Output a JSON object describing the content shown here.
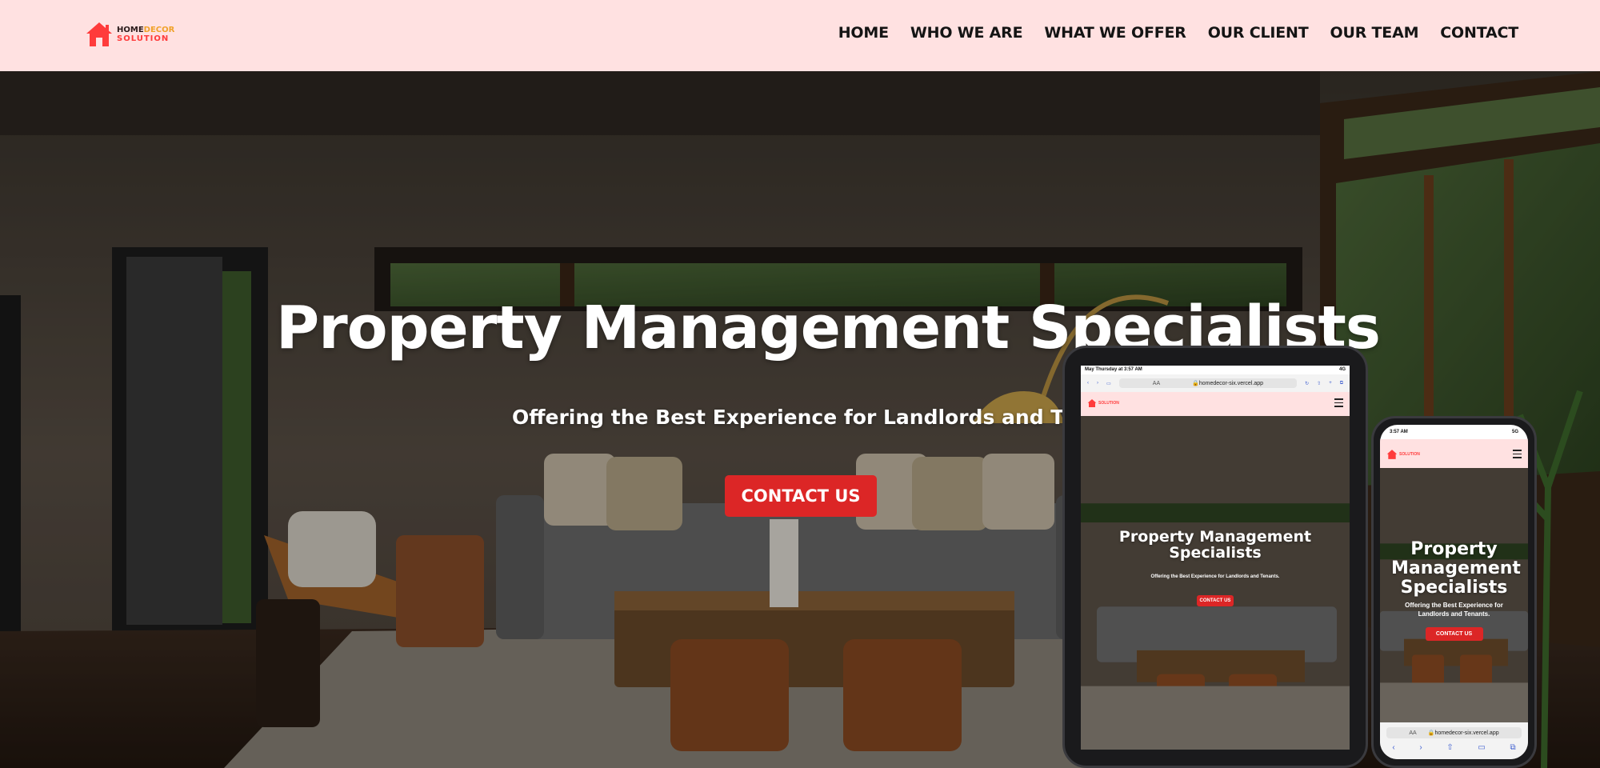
{
  "logo": {
    "line1_a": "HOME",
    "line1_b": "DECOR",
    "line2": "SOLUTION",
    "icon": "house-icon"
  },
  "nav": [
    "HOME",
    "WHO WE ARE",
    "WHAT WE OFFER",
    "OUR CLIENT",
    "OUR TEAM",
    "CONTACT"
  ],
  "hero": {
    "title": "Property Management Specialists",
    "subtitle": "Offering the Best Experience for Landlords and Tenan",
    "cta": "CONTACT US"
  },
  "tablet": {
    "status_time": "May Thursday at 3:57 AM",
    "status_right": "4G",
    "url": "homedecor-six.vercel.app",
    "reader": "AA",
    "title": "Property Management Specialists",
    "subtitle": "Offering the Best Experience for Landlords and Tenants.",
    "cta": "CONTACT US"
  },
  "phone": {
    "status_time": "3:57 AM",
    "status_right": "5G",
    "url": "homedecor-six.vercel.app",
    "reader": "AA",
    "title": "Property Management Specialists",
    "subtitle": "Offering the Best Experience for Landlords and Tenants.",
    "cta": "CONTACT US"
  },
  "colors": {
    "header_bg": "#ffe1e1",
    "accent": "#dc2626",
    "brand_red": "#ff3b3b",
    "brand_orange": "#f0a22a"
  }
}
